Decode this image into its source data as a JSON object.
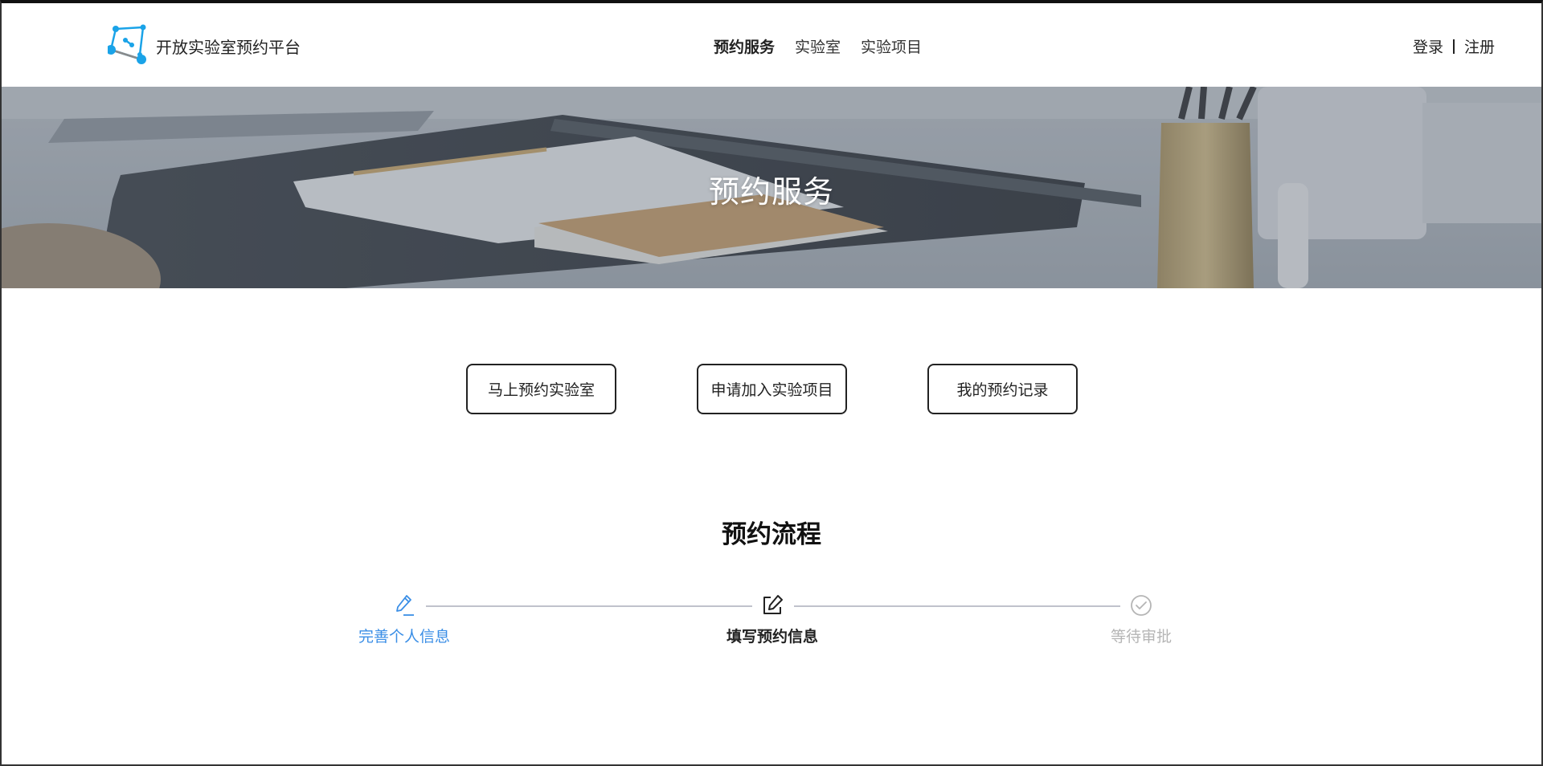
{
  "header": {
    "brand_name": "开放实验室预约平台",
    "brand_logo_icon": "network-nodes-logo",
    "nav": [
      {
        "label": "预约服务",
        "active": true
      },
      {
        "label": "实验室",
        "active": false
      },
      {
        "label": "实验项目",
        "active": false
      }
    ],
    "login_label": "登录",
    "register_label": "注册"
  },
  "banner": {
    "title": "预约服务"
  },
  "actions": [
    {
      "label": "马上预约实验室"
    },
    {
      "label": "申请加入实验项目"
    },
    {
      "label": "我的预约记录"
    }
  ],
  "process": {
    "title": "预约流程",
    "steps": [
      {
        "label": "完善个人信息",
        "icon": "pencil-icon",
        "state": "done"
      },
      {
        "label": "填写预约信息",
        "icon": "edit-icon",
        "state": "current"
      },
      {
        "label": "等待审批",
        "icon": "check-circle-icon",
        "state": "pending"
      }
    ]
  },
  "colors": {
    "brand_blue": "#1aa3e8",
    "step_done": "#3a8ee6",
    "step_pending": "#b5b5b5",
    "step_line": "#c0c2cc"
  }
}
